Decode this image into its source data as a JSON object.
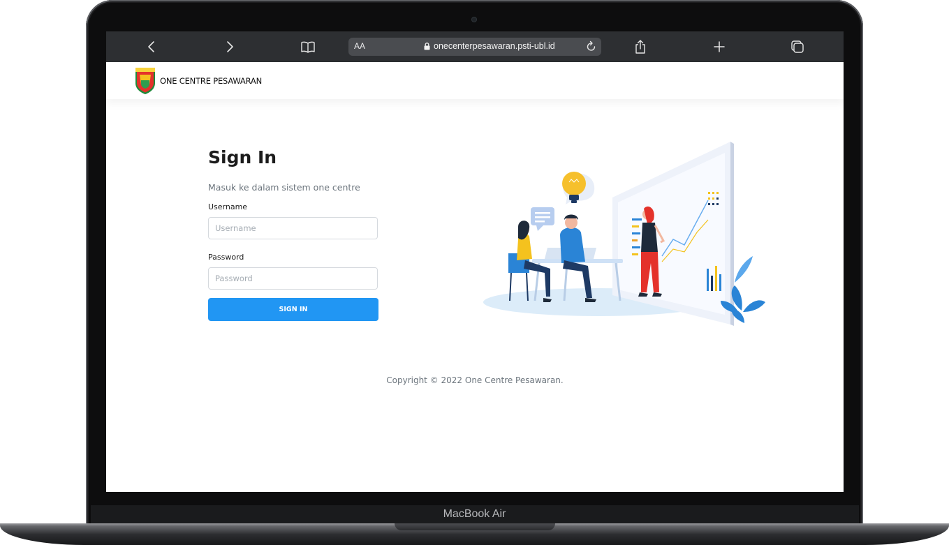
{
  "device": {
    "model_label": "MacBook Air"
  },
  "browser": {
    "back_icon": "chevron-left-icon",
    "forward_icon": "chevron-right-icon",
    "bookmarks_icon": "book-icon",
    "text_size_label": "AA",
    "lock_icon": "lock-icon",
    "url": "onecenterpesawaran.psti-ubl.id",
    "reload_icon": "reload-icon",
    "share_icon": "share-icon",
    "new_tab_icon": "plus-icon",
    "tabs_icon": "tabs-icon"
  },
  "header": {
    "logo_text": "PESAWARAN",
    "brand": "ONE CENTRE PESAWARAN"
  },
  "login": {
    "title": "Sign In",
    "subtitle": "Masuk ke dalam sistem one centre",
    "username_label": "Username",
    "username_placeholder": "Username",
    "username_value": "",
    "password_label": "Password",
    "password_placeholder": "Password",
    "password_value": "",
    "submit_label": "SIGN IN"
  },
  "footer": {
    "copyright": "Copyright © 2022 One Centre Pesawaran."
  },
  "colors": {
    "primary": "#2196f3",
    "browser_toolbar": "#2d2f32",
    "laptop_frame": "#0d0d0e"
  }
}
